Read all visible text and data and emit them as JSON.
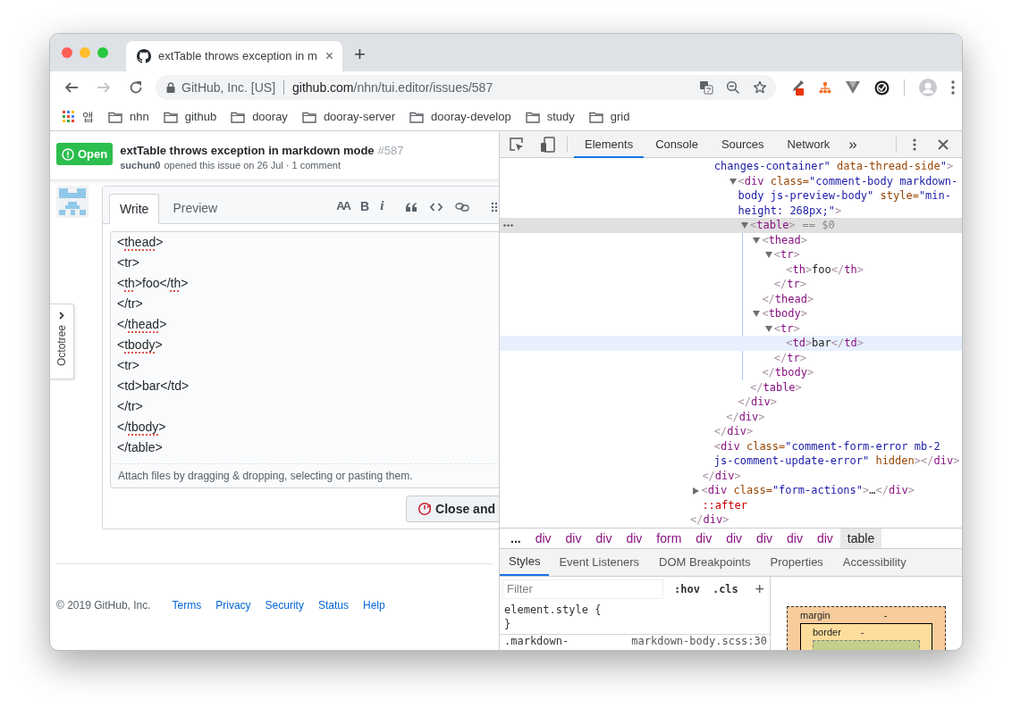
{
  "browser": {
    "tab": {
      "title": "extTable throws exception in m",
      "close": "×"
    },
    "new_tab": "+",
    "nav": [
      {
        "kind": "back",
        "disabled": false
      },
      {
        "kind": "forward",
        "disabled": true
      },
      {
        "kind": "reload",
        "disabled": false
      }
    ],
    "address": {
      "site_identity": "GitHub, Inc. [US]",
      "host": "github.com",
      "path": "/nhn/tui.editor/issues/587"
    },
    "bookmarks": [
      {
        "kind": "apps",
        "label": "앱"
      },
      {
        "kind": "folder",
        "label": "nhn"
      },
      {
        "kind": "folder",
        "label": "github"
      },
      {
        "kind": "folder",
        "label": "dooray"
      },
      {
        "kind": "folder",
        "label": "dooray-server"
      },
      {
        "kind": "folder",
        "label": "dooray-develop"
      },
      {
        "kind": "folder",
        "label": "study"
      },
      {
        "kind": "folder",
        "label": "grid"
      }
    ]
  },
  "issue": {
    "state": "Open",
    "title": "extTable throws exception in markdown mode",
    "number": "#587",
    "author": "suchun0",
    "meta": "opened this issue on 26 Jul · 1 comment"
  },
  "editor": {
    "tabs": [
      {
        "label": "Write",
        "selected": true
      },
      {
        "label": "Preview",
        "selected": false
      }
    ],
    "format_buttons": [
      {
        "kind": "text-size",
        "glyph": "AA"
      },
      {
        "kind": "bold",
        "glyph": "B"
      },
      {
        "kind": "italic",
        "glyph": "i"
      }
    ],
    "lines": [
      [
        {
          "text": "<",
          "misspelled": false
        },
        {
          "text": "thead",
          "misspelled": true
        },
        {
          "text": ">",
          "misspelled": false
        }
      ],
      [
        {
          "text": "<tr>",
          "misspelled": false
        }
      ],
      [
        {
          "text": "<",
          "misspelled": false
        },
        {
          "text": "th",
          "misspelled": true
        },
        {
          "text": ">foo</",
          "misspelled": false
        },
        {
          "text": "th",
          "misspelled": true
        },
        {
          "text": ">",
          "misspelled": false
        }
      ],
      [
        {
          "text": "</tr>",
          "misspelled": false
        }
      ],
      [
        {
          "text": "</",
          "misspelled": false
        },
        {
          "text": "thead",
          "misspelled": true
        },
        {
          "text": ">",
          "misspelled": false
        }
      ],
      [
        {
          "text": "<",
          "misspelled": false
        },
        {
          "text": "tbody",
          "misspelled": true
        },
        {
          "text": ">",
          "misspelled": false
        }
      ],
      [
        {
          "text": "<tr>",
          "misspelled": false
        }
      ],
      [
        {
          "text": "<td>bar</td>",
          "misspelled": false
        }
      ],
      [
        {
          "text": "</tr>",
          "misspelled": false
        }
      ],
      [
        {
          "text": "</",
          "misspelled": false
        },
        {
          "text": "tbody",
          "misspelled": true
        },
        {
          "text": ">",
          "misspelled": false
        }
      ],
      [
        {
          "text": "</table>",
          "misspelled": false
        }
      ]
    ],
    "attach_hint": "Attach files by dragging & dropping, selecting or pasting them.",
    "close_button": "Close and"
  },
  "octotree": {
    "label": "Octotree"
  },
  "footer": {
    "copyright": "© 2019 GitHub, Inc.",
    "links": [
      "Terms",
      "Privacy",
      "Security",
      "Status",
      "Help"
    ]
  },
  "devtools": {
    "tabs": [
      {
        "label": "Elements",
        "selected": true
      },
      {
        "label": "Console",
        "selected": false
      },
      {
        "label": "Sources",
        "selected": false
      },
      {
        "label": "Network",
        "selected": false
      }
    ],
    "more_tabs": "»",
    "selection_marker": "== $0",
    "dom_tree": {
      "close": [
        {
          "kind": "bracket",
          "text": "</"
        },
        {
          "kind": "tag",
          "text": "div"
        },
        {
          "kind": "bracket",
          "text": ">"
        }
      ],
      "children": [
        {
          "close": [
            {
              "kind": "bracket",
              "text": "</"
            },
            {
              "kind": "tag",
              "text": "div"
            },
            {
              "kind": "bracket",
              "text": ">"
            }
          ],
          "children": [
            {
              "open": [
                {
                  "kind": "value",
                  "text": "changes-container\""
                },
                {
                  "kind": "attr",
                  "text": " data-thread-side"
                },
                {
                  "kind": "value",
                  "text": "\""
                },
                {
                  "kind": "bracket",
                  "text": ">"
                }
              ],
              "selected": false,
              "hovered": false,
              "close": [
                {
                  "kind": "bracket",
                  "text": "</"
                },
                {
                  "kind": "tag",
                  "text": "div"
                },
                {
                  "kind": "bracket",
                  "text": ">"
                }
              ],
              "children": [
                {
                  "close": [
                    {
                      "kind": "bracket",
                      "text": "</"
                    },
                    {
                      "kind": "tag",
                      "text": "div"
                    },
                    {
                      "kind": "bracket",
                      "text": ">"
                    }
                  ],
                  "children": [
                    {
                      "open": [
                        {
                          "kind": "bracket",
                          "text": "<"
                        },
                        {
                          "kind": "tag",
                          "text": "div"
                        },
                        {
                          "kind": "attr",
                          "text": " class="
                        },
                        {
                          "kind": "value",
                          "text": "\"comment-body markdown-body js-preview-body\""
                        },
                        {
                          "kind": "attr",
                          "text": " style="
                        },
                        {
                          "kind": "value",
                          "text": "\"min-height: 268px;\""
                        },
                        {
                          "kind": "bracket",
                          "text": ">"
                        }
                      ],
                      "expanded": true,
                      "selected": false,
                      "hovered": false,
                      "close": [
                        {
                          "kind": "bracket",
                          "text": "</"
                        },
                        {
                          "kind": "tag",
                          "text": "div"
                        },
                        {
                          "kind": "bracket",
                          "text": ">"
                        }
                      ],
                      "children": [
                        {
                          "open": [
                            {
                              "kind": "bracket",
                              "text": "<"
                            },
                            {
                              "kind": "tag",
                              "text": "table"
                            },
                            {
                              "kind": "bracket",
                              "text": ">"
                            }
                          ],
                          "expanded": true,
                          "selected": true,
                          "hovered": false,
                          "close": [
                            {
                              "kind": "bracket",
                              "text": "</"
                            },
                            {
                              "kind": "tag",
                              "text": "table"
                            },
                            {
                              "kind": "bracket",
                              "text": ">"
                            }
                          ],
                          "children": [
                            {
                              "open": [
                                {
                                  "kind": "bracket",
                                  "text": "<"
                                },
                                {
                                  "kind": "tag",
                                  "text": "thead"
                                },
                                {
                                  "kind": "bracket",
                                  "text": ">"
                                }
                              ],
                              "expanded": true,
                              "selected": false,
                              "hovered": false,
                              "close": [
                                {
                                  "kind": "bracket",
                                  "text": "</"
                                },
                                {
                                  "kind": "tag",
                                  "text": "thead"
                                },
                                {
                                  "kind": "bracket",
                                  "text": ">"
                                }
                              ],
                              "children": [
                                {
                                  "open": [
                                    {
                                      "kind": "bracket",
                                      "text": "<"
                                    },
                                    {
                                      "kind": "tag",
                                      "text": "tr"
                                    },
                                    {
                                      "kind": "bracket",
                                      "text": ">"
                                    }
                                  ],
                                  "expanded": true,
                                  "selected": false,
                                  "hovered": false,
                                  "close": [
                                    {
                                      "kind": "bracket",
                                      "text": "</"
                                    },
                                    {
                                      "kind": "tag",
                                      "text": "tr"
                                    },
                                    {
                                      "kind": "bracket",
                                      "text": ">"
                                    }
                                  ],
                                  "children": [
                                    {
                                      "open": [
                                        {
                                          "kind": "bracket",
                                          "text": "<"
                                        },
                                        {
                                          "kind": "tag",
                                          "text": "th"
                                        },
                                        {
                                          "kind": "bracket",
                                          "text": ">"
                                        },
                                        {
                                          "kind": "text",
                                          "text": "foo"
                                        },
                                        {
                                          "kind": "bracket",
                                          "text": "</"
                                        },
                                        {
                                          "kind": "tag",
                                          "text": "th"
                                        },
                                        {
                                          "kind": "bracket",
                                          "text": ">"
                                        }
                                      ],
                                      "selected": false,
                                      "hovered": false
                                    }
                                  ]
                                }
                              ]
                            },
                            {
                              "open": [
                                {
                                  "kind": "bracket",
                                  "text": "<"
                                },
                                {
                                  "kind": "tag",
                                  "text": "tbody"
                                },
                                {
                                  "kind": "bracket",
                                  "text": ">"
                                }
                              ],
                              "expanded": true,
                              "selected": false,
                              "hovered": false,
                              "close": [
                                {
                                  "kind": "bracket",
                                  "text": "</"
                                },
                                {
                                  "kind": "tag",
                                  "text": "tbody"
                                },
                                {
                                  "kind": "bracket",
                                  "text": ">"
                                }
                              ],
                              "children": [
                                {
                                  "open": [
                                    {
                                      "kind": "bracket",
                                      "text": "<"
                                    },
                                    {
                                      "kind": "tag",
                                      "text": "tr"
                                    },
                                    {
                                      "kind": "bracket",
                                      "text": ">"
                                    }
                                  ],
                                  "expanded": true,
                                  "selected": false,
                                  "hovered": false,
                                  "close": [
                                    {
                                      "kind": "bracket",
                                      "text": "</"
                                    },
                                    {
                                      "kind": "tag",
                                      "text": "tr"
                                    },
                                    {
                                      "kind": "bracket",
                                      "text": ">"
                                    }
                                  ],
                                  "children": [
                                    {
                                      "open": [
                                        {
                                          "kind": "bracket",
                                          "text": "<"
                                        },
                                        {
                                          "kind": "tag",
                                          "text": "td"
                                        },
                                        {
                                          "kind": "bracket",
                                          "text": ">"
                                        },
                                        {
                                          "kind": "text",
                                          "text": "bar"
                                        },
                                        {
                                          "kind": "bracket",
                                          "text": "</"
                                        },
                                        {
                                          "kind": "tag",
                                          "text": "td"
                                        },
                                        {
                                          "kind": "bracket",
                                          "text": ">"
                                        }
                                      ],
                                      "selected": false,
                                      "hovered": true
                                    }
                                  ]
                                }
                              ]
                            }
                          ]
                        }
                      ]
                    }
                  ]
                }
              ]
            },
            {
              "open": [
                {
                  "kind": "bracket",
                  "text": "<"
                },
                {
                  "kind": "tag",
                  "text": "div"
                },
                {
                  "kind": "attr",
                  "text": " class="
                },
                {
                  "kind": "value",
                  "text": "\"comment-form-error mb-2 js-comment-update-error\""
                },
                {
                  "kind": "attr",
                  "text": " hidden"
                },
                {
                  "kind": "bracket",
                  "text": "></"
                },
                {
                  "kind": "tag",
                  "text": "div"
                },
                {
                  "kind": "bracket",
                  "text": ">"
                }
              ],
              "selected": false,
              "hovered": false
            }
          ]
        },
        {
          "open": [
            {
              "kind": "bracket",
              "text": "<"
            },
            {
              "kind": "tag",
              "text": "div"
            },
            {
              "kind": "attr",
              "text": " class="
            },
            {
              "kind": "value",
              "text": "\"form-actions\""
            },
            {
              "kind": "bracket",
              "text": ">"
            },
            {
              "kind": "text",
              "text": "…"
            },
            {
              "kind": "bracket",
              "text": "</"
            },
            {
              "kind": "tag",
              "text": "div"
            },
            {
              "kind": "bracket",
              "text": ">"
            }
          ],
          "expanded": false,
          "selected": false,
          "hovered": false
        },
        {
          "open": [
            {
              "kind": "pseudo",
              "text": "::after"
            }
          ],
          "selected": false,
          "hovered": false
        }
      ]
    },
    "breadcrumbs": [
      {
        "kind": "overflow",
        "label": "...",
        "selected": false
      },
      {
        "kind": "tag",
        "label": "div",
        "selected": false
      },
      {
        "kind": "tag",
        "label": "div",
        "selected": false
      },
      {
        "kind": "tag",
        "label": "div",
        "selected": false
      },
      {
        "kind": "tag",
        "label": "div",
        "selected": false
      },
      {
        "kind": "tag",
        "label": "form",
        "selected": false
      },
      {
        "kind": "tag",
        "label": "div",
        "selected": false
      },
      {
        "kind": "tag",
        "label": "div",
        "selected": false
      },
      {
        "kind": "tag",
        "label": "div",
        "selected": false
      },
      {
        "kind": "tag",
        "label": "div",
        "selected": false
      },
      {
        "kind": "tag",
        "label": "div",
        "selected": false
      },
      {
        "kind": "tag",
        "label": "table",
        "selected": true
      }
    ],
    "pane_tabs": [
      {
        "label": "Styles",
        "selected": true
      },
      {
        "label": "Event Listeners",
        "selected": false
      },
      {
        "label": "DOM Breakpoints",
        "selected": false
      },
      {
        "label": "Properties",
        "selected": false
      },
      {
        "label": "Accessibility",
        "selected": false
      }
    ],
    "styles": {
      "filter_placeholder": "Filter",
      "hov": ":hov",
      "cls": ".cls",
      "add": "+",
      "element_style": "element.style {",
      "element_style_close": "}",
      "rule_selector": ".markdown-",
      "rule_source": "markdown-body.scss:30"
    },
    "box_model": {
      "margin_label": "margin",
      "margin_value": "-",
      "border_label": "border",
      "border_value": "-"
    }
  }
}
